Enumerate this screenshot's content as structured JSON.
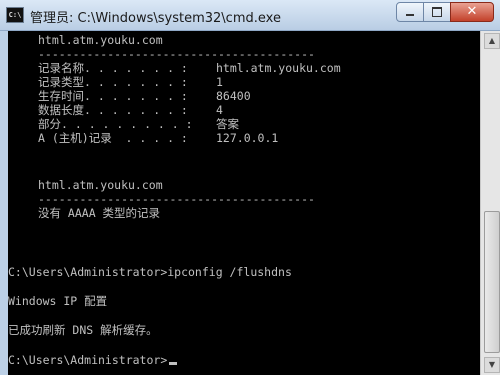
{
  "window": {
    "title": "管理员: C:\\Windows\\system32\\cmd.exe"
  },
  "console": {
    "block1_host": "html.atm.youku.com",
    "block1_sep": "----------------------------------------",
    "records": [
      {
        "label": "记录名称. . . . . . . :",
        "value": "html.atm.youku.com"
      },
      {
        "label": "记录类型. . . . . . . :",
        "value": "1"
      },
      {
        "label": "生存时间. . . . . . . :",
        "value": "86400"
      },
      {
        "label": "数据长度. . . . . . . :",
        "value": "4"
      },
      {
        "label": "部分. . . . . . . . . :",
        "value": "答案"
      },
      {
        "label": "A (主机)记录  . . . . :",
        "value": "127.0.0.1"
      }
    ],
    "block2_host": "html.atm.youku.com",
    "block2_sep": "----------------------------------------",
    "no_aaaa": "没有 AAAA 类型的记录",
    "cmd_prompt": "C:\\Users\\Administrator>ipconfig /flushdns",
    "ip_config_header": "Windows IP 配置",
    "flush_success": "已成功刷新 DNS 解析缓存。",
    "final_prompt": "C:\\Users\\Administrator>"
  }
}
